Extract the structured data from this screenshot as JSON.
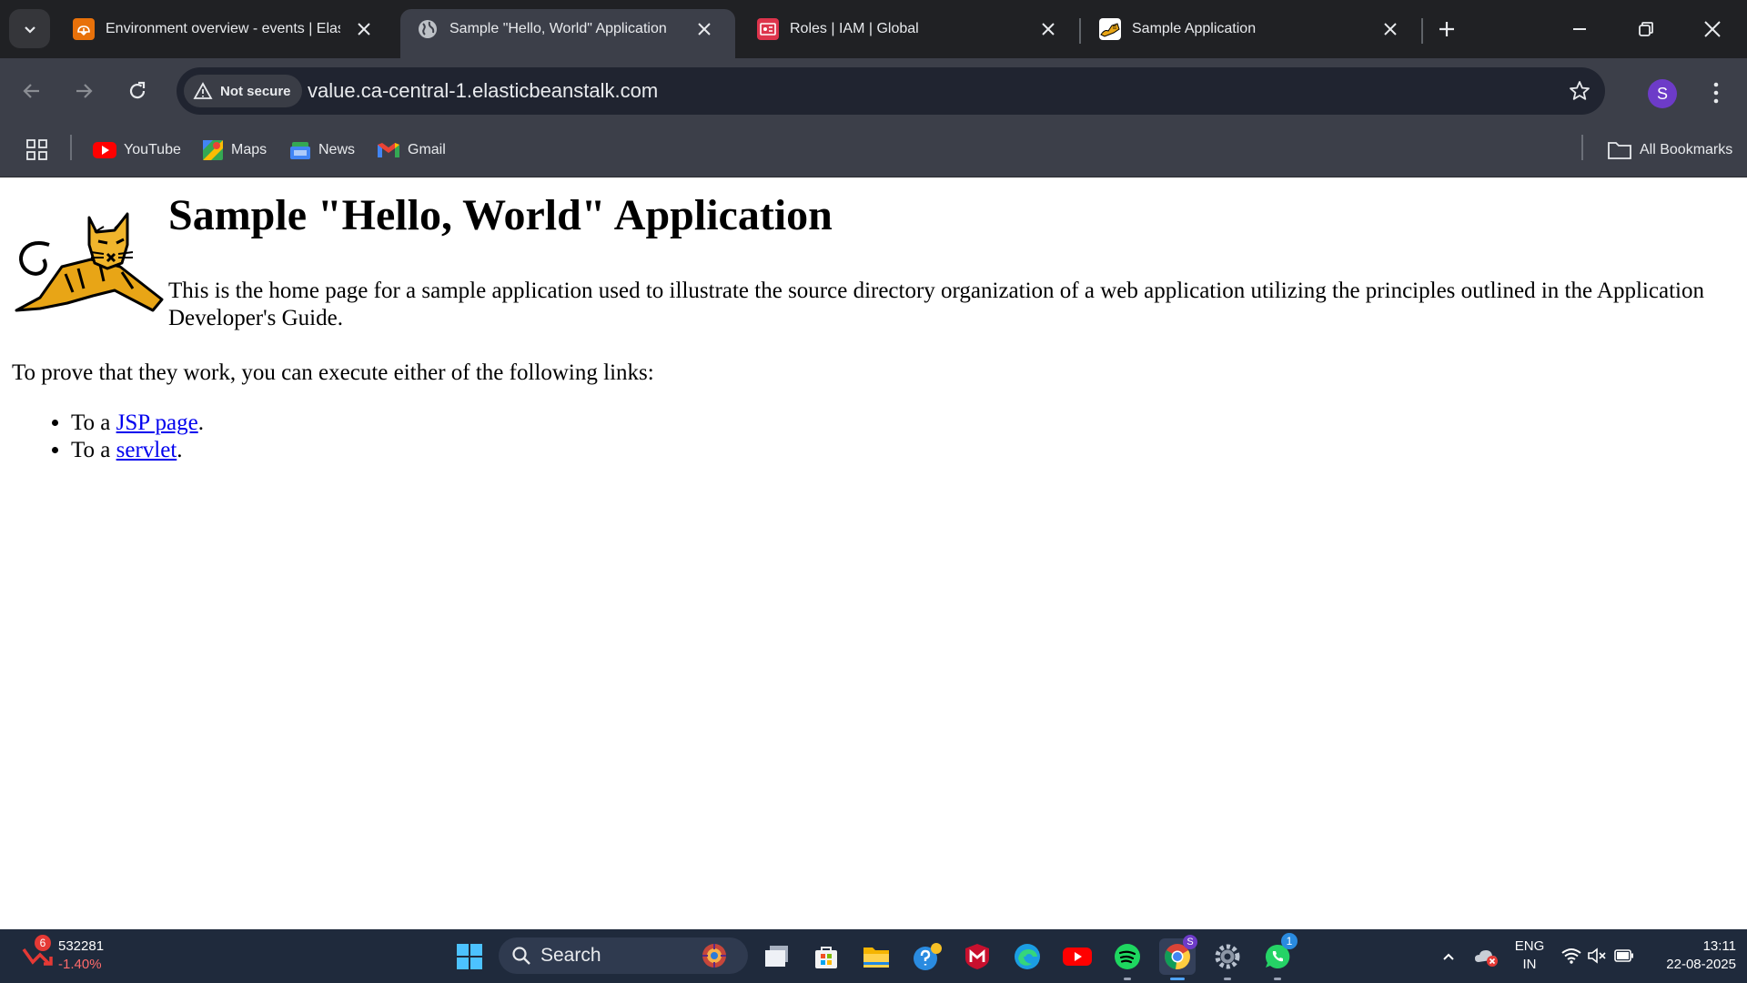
{
  "browser": {
    "tabs": [
      {
        "title": "Environment overview - events | Elastic Beanstalk",
        "favicon": "elastic-beanstalk-icon",
        "active": false
      },
      {
        "title": "Sample \"Hello, World\" Application",
        "favicon": "globe-icon",
        "active": true
      },
      {
        "title": "Roles | IAM | Global",
        "favicon": "iam-icon",
        "active": false
      },
      {
        "title": "Sample Application",
        "favicon": "tomcat-icon",
        "active": false
      }
    ],
    "security_label": "Not secure",
    "url": "value.ca-central-1.elasticbeanstalk.com",
    "profile_initial": "S",
    "bookmarks": [
      {
        "label": "YouTube",
        "icon": "youtube-icon"
      },
      {
        "label": "Maps",
        "icon": "maps-icon"
      },
      {
        "label": "News",
        "icon": "news-icon"
      },
      {
        "label": "Gmail",
        "icon": "gmail-icon"
      }
    ],
    "all_bookmarks_label": "All Bookmarks"
  },
  "page": {
    "heading": "Sample \"Hello, World\" Application",
    "intro": "This is the home page for a sample application used to illustrate the source directory organization of a web application utilizing the principles outlined in the Application Developer's Guide.",
    "prove": "To prove that they work, you can execute either of the following links:",
    "links": [
      {
        "prefix": "To a ",
        "link_text": "JSP page",
        "suffix": "."
      },
      {
        "prefix": "To a ",
        "link_text": "servlet",
        "suffix": "."
      }
    ]
  },
  "taskbar": {
    "stock": {
      "badge": "6",
      "value": "532281",
      "change": "-1.40%"
    },
    "search_label": "Search",
    "whatsapp_badge": "1",
    "chrome_badge": "S",
    "language": {
      "line1": "ENG",
      "line2": "IN"
    },
    "time": "13:11",
    "date": "22-08-2025"
  },
  "colors": {
    "link": "#0000ee",
    "tab_strip": "#202124",
    "toolbar": "#3c3f49",
    "taskbar": "#1f2a3c",
    "stock_down": "#ff6b6b"
  }
}
